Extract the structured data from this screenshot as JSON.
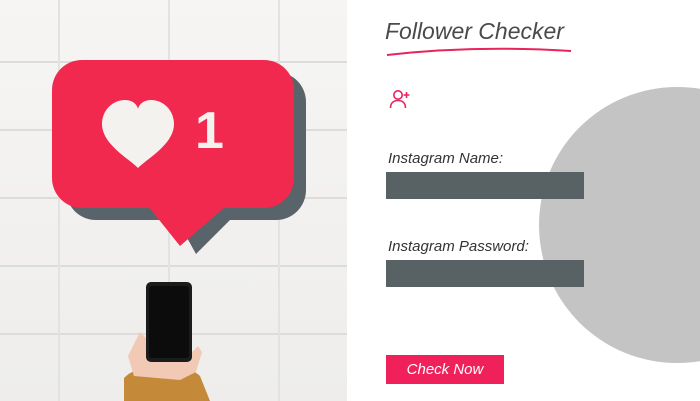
{
  "hero": {
    "notification_count": "1",
    "colors": {
      "bubble": "#f2294f",
      "shadow": "#59636a",
      "sleeve": "#c48a3a"
    },
    "icons": [
      "heart-icon",
      "phone-icon"
    ]
  },
  "form": {
    "title": "Follower Checker",
    "accent_color": "#e8245e",
    "user_icon": "user-plus-icon",
    "name_label": "Instagram Name:",
    "name_value": "",
    "password_label": "Instagram Password:",
    "password_value": "",
    "submit_label": "Check Now"
  }
}
